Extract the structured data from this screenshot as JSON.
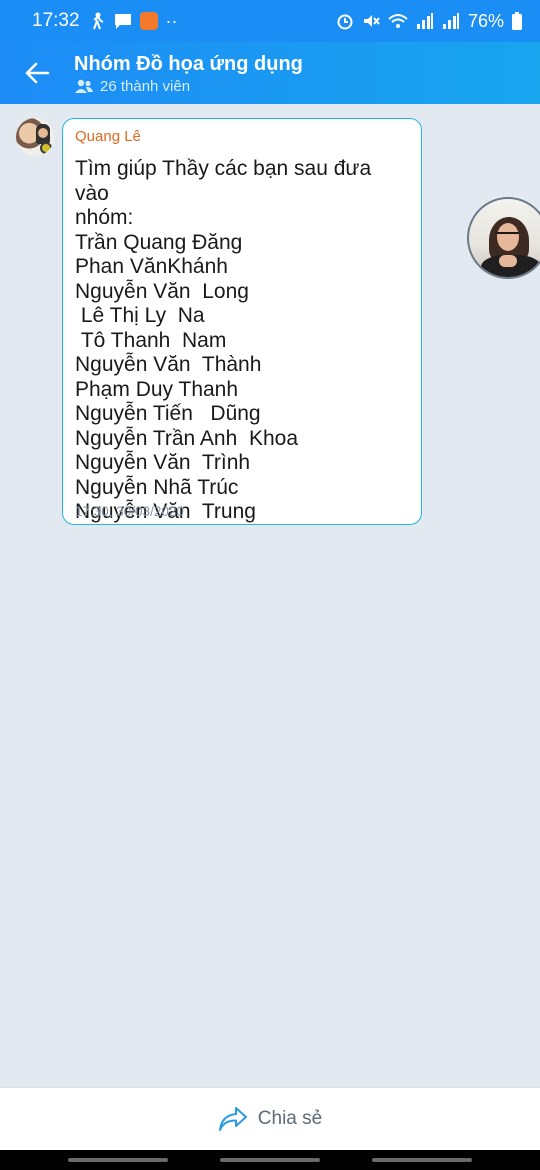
{
  "status_bar": {
    "time": "17:32",
    "battery": "76%",
    "left_icons": [
      "person-walk-icon",
      "chat-bubble-icon",
      "app-notification-icon",
      "more-dots-icon"
    ],
    "right_icons": [
      "alarm-icon",
      "mute-icon",
      "wifi-icon",
      "signal-icon",
      "signal-icon",
      "battery-icon"
    ]
  },
  "header": {
    "title": "Nhóm Đồ họa ứng dụng",
    "member_count": "26 thành viên",
    "accent_color": "#1a8ef5"
  },
  "message": {
    "sender": "Quang Lê",
    "text": "Tìm giúp Thầy các bạn sau đưa vào\nnhóm:\nTrần Quang Đăng\nPhan VănKhánh\nNguyễn Văn  Long\n Lê Thị Ly  Na\n Tô Thanh  Nam\nNguyễn Văn  Thành\nPhạm Duy Thanh\nNguyễn Tiến   Dũng\nNguyễn Trần Anh  Khoa\nNguyễn Văn  Trình\nNguyễn Nhã Trúc\nNguyễn Văn  Trung",
    "timestamp": "17:30, 30/03/2020",
    "border_color": "#25b6df",
    "sender_color": "#e0691f"
  },
  "footer": {
    "share_label": "Chia sẻ"
  }
}
